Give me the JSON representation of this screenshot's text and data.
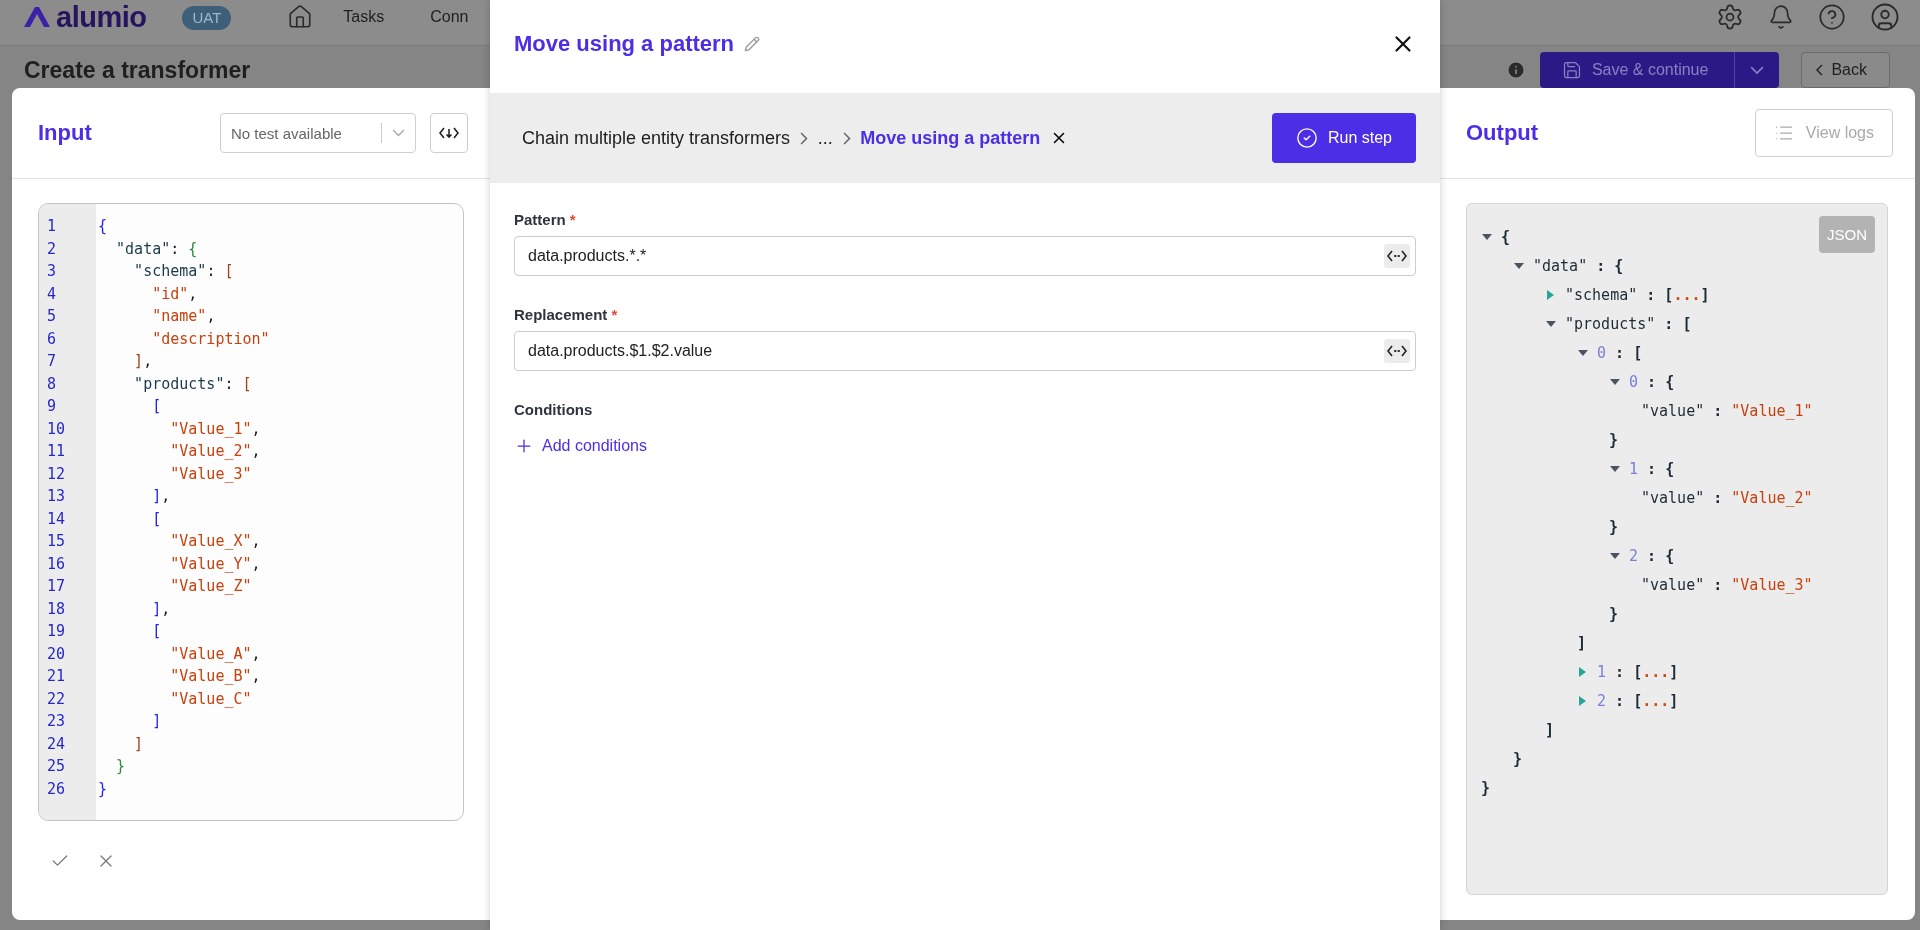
{
  "nav": {
    "logo": "alumio",
    "env_badge": "UAT",
    "items": [
      "Tasks",
      "Conn"
    ]
  },
  "page": {
    "title": "Create a transformer",
    "save_button": "Save & continue",
    "back_button": "Back"
  },
  "input": {
    "title": "Input",
    "test_select": "No test available",
    "lines": [
      {
        "number": "1",
        "tokens": [
          {
            "kind": "rootbracket",
            "t": "{"
          }
        ]
      },
      {
        "number": "2",
        "tokens": [
          {
            "kind": "key",
            "t": "  \"data\""
          },
          {
            "kind": "punct",
            "t": ": "
          },
          {
            "kind": "objectbracket",
            "t": "{"
          }
        ]
      },
      {
        "number": "3",
        "tokens": [
          {
            "kind": "key",
            "t": "    \"schema\""
          },
          {
            "kind": "punct",
            "t": ": "
          },
          {
            "kind": "listbracket",
            "t": "["
          }
        ]
      },
      {
        "number": "4",
        "tokens": [
          {
            "kind": "string",
            "t": "      \"id\""
          },
          {
            "kind": "punct",
            "t": ","
          }
        ]
      },
      {
        "number": "5",
        "tokens": [
          {
            "kind": "string",
            "t": "      \"name\""
          },
          {
            "kind": "punct",
            "t": ","
          }
        ]
      },
      {
        "number": "6",
        "tokens": [
          {
            "kind": "string",
            "t": "      \"description\""
          }
        ]
      },
      {
        "number": "7",
        "tokens": [
          {
            "kind": "listbracket",
            "t": "    ]"
          },
          {
            "kind": "punct",
            "t": ","
          }
        ]
      },
      {
        "number": "8",
        "tokens": [
          {
            "kind": "key",
            "t": "    \"products\""
          },
          {
            "kind": "punct",
            "t": ": "
          },
          {
            "kind": "listbracket",
            "t": "["
          }
        ]
      },
      {
        "number": "9",
        "tokens": [
          {
            "kind": "itembracket",
            "t": "      ["
          }
        ]
      },
      {
        "number": "10",
        "tokens": [
          {
            "kind": "string",
            "t": "        \"Value_1\""
          },
          {
            "kind": "punct",
            "t": ","
          }
        ]
      },
      {
        "number": "11",
        "tokens": [
          {
            "kind": "string",
            "t": "        \"Value_2\""
          },
          {
            "kind": "punct",
            "t": ","
          }
        ]
      },
      {
        "number": "12",
        "tokens": [
          {
            "kind": "string",
            "t": "        \"Value_3\""
          }
        ]
      },
      {
        "number": "13",
        "tokens": [
          {
            "kind": "itembracket",
            "t": "      ]"
          },
          {
            "kind": "punct",
            "t": ","
          }
        ]
      },
      {
        "number": "14",
        "tokens": [
          {
            "kind": "itembracket",
            "t": "      ["
          }
        ]
      },
      {
        "number": "15",
        "tokens": [
          {
            "kind": "string",
            "t": "        \"Value_X\""
          },
          {
            "kind": "punct",
            "t": ","
          }
        ]
      },
      {
        "number": "16",
        "tokens": [
          {
            "kind": "string",
            "t": "        \"Value_Y\""
          },
          {
            "kind": "punct",
            "t": ","
          }
        ]
      },
      {
        "number": "17",
        "tokens": [
          {
            "kind": "string",
            "t": "        \"Value_Z\""
          }
        ]
      },
      {
        "number": "18",
        "tokens": [
          {
            "kind": "itembracket",
            "t": "      ]"
          },
          {
            "kind": "punct",
            "t": ","
          }
        ]
      },
      {
        "number": "19",
        "tokens": [
          {
            "kind": "itembracket",
            "t": "      ["
          }
        ]
      },
      {
        "number": "20",
        "tokens": [
          {
            "kind": "string",
            "t": "        \"Value_A\""
          },
          {
            "kind": "punct",
            "t": ","
          }
        ]
      },
      {
        "number": "21",
        "tokens": [
          {
            "kind": "string",
            "t": "        \"Value_B\""
          },
          {
            "kind": "punct",
            "t": ","
          }
        ]
      },
      {
        "number": "22",
        "tokens": [
          {
            "kind": "string",
            "t": "        \"Value_C\""
          }
        ]
      },
      {
        "number": "23",
        "tokens": [
          {
            "kind": "itembracket",
            "t": "      ]"
          }
        ]
      },
      {
        "number": "24",
        "tokens": [
          {
            "kind": "listbracket",
            "t": "    ]"
          }
        ]
      },
      {
        "number": "25",
        "tokens": [
          {
            "kind": "objectbracket",
            "t": "  }"
          }
        ]
      },
      {
        "number": "26",
        "tokens": [
          {
            "kind": "rootbracket",
            "t": "}"
          }
        ]
      }
    ]
  },
  "output": {
    "title": "Output",
    "view_logs": "View logs",
    "format_badge": "JSON",
    "tree": {
      "expanded": true,
      "open": "{",
      "close": "}",
      "children": [
        {
          "key": "\"data\"",
          "kind": "name",
          "sep": ":",
          "expanded": true,
          "open": "{",
          "close": "}",
          "children": [
            {
              "key": "\"schema\"",
              "kind": "name",
              "sep": ":",
              "expanded": false,
              "open": "[",
              "close": "]",
              "hidden": "..."
            },
            {
              "key": "\"products\"",
              "kind": "name",
              "sep": ":",
              "expanded": true,
              "open": "[",
              "close": "]",
              "children": [
                {
                  "key": "0",
                  "kind": "index",
                  "sep": ":",
                  "expanded": true,
                  "open": "[",
                  "close": "]",
                  "children": [
                    {
                      "key": "0",
                      "kind": "index",
                      "sep": ":",
                      "expanded": true,
                      "open": "{",
                      "close": "}",
                      "children": [
                        {
                          "key": "\"value\"",
                          "kind": "name",
                          "sep": ":",
                          "value": "\"Value_1\""
                        }
                      ]
                    },
                    {
                      "key": "1",
                      "kind": "index",
                      "sep": ":",
                      "expanded": true,
                      "open": "{",
                      "close": "}",
                      "children": [
                        {
                          "key": "\"value\"",
                          "kind": "name",
                          "sep": ":",
                          "value": "\"Value_2\""
                        }
                      ]
                    },
                    {
                      "key": "2",
                      "kind": "index",
                      "sep": ":",
                      "expanded": true,
                      "open": "{",
                      "close": "}",
                      "children": [
                        {
                          "key": "\"value\"",
                          "kind": "name",
                          "sep": ":",
                          "value": "\"Value_3\""
                        }
                      ]
                    }
                  ]
                },
                {
                  "key": "1",
                  "kind": "index",
                  "sep": ":",
                  "expanded": false,
                  "open": "[",
                  "close": "]",
                  "hidden": "..."
                },
                {
                  "key": "2",
                  "kind": "index",
                  "sep": ":",
                  "expanded": false,
                  "open": "[",
                  "close": "]",
                  "hidden": "..."
                }
              ]
            }
          ]
        }
      ]
    }
  },
  "modal": {
    "title": "Move using a pattern",
    "breadcrumbs": [
      {
        "label": "Chain multiple entity transformers",
        "current": false
      },
      {
        "label": "...",
        "current": false
      },
      {
        "label": "Move using a pattern",
        "current": true
      }
    ],
    "run_button": "Run step",
    "fields": [
      {
        "label": "Pattern",
        "required_mark": "*",
        "value": "data.products.*.*"
      },
      {
        "label": "Replacement",
        "required_mark": "*",
        "value": "data.products.$1.$2.value"
      }
    ],
    "conditions": {
      "label": "Conditions",
      "add_button": "Add conditions"
    }
  }
}
